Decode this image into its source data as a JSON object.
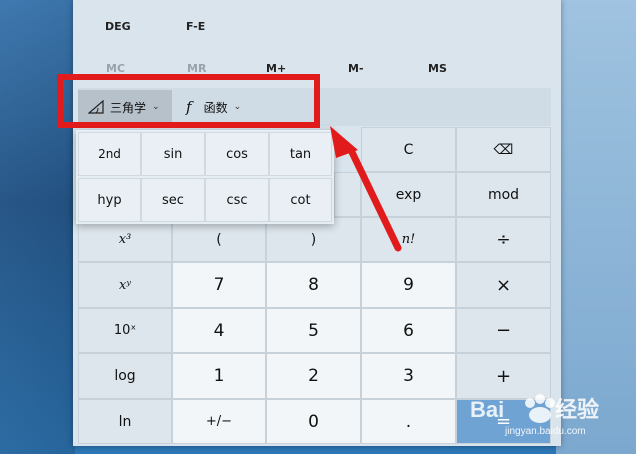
{
  "mode_row": {
    "deg": "DEG",
    "fe": "F-E"
  },
  "memory_row": {
    "mc": "MC",
    "mr": "MR",
    "mplus": "M+",
    "mminus": "M-",
    "ms": "MS"
  },
  "dropdowns": {
    "trig_label": "三角学",
    "func_label": "函数",
    "func_glyph": "f"
  },
  "popup_buttons": {
    "second": "2nd",
    "sin": "sin",
    "cos": "cos",
    "tan": "tan",
    "hyp": "hyp",
    "sec": "sec",
    "csc": "csc",
    "cot": "cot"
  },
  "keys": {
    "clear": "C",
    "backspace": "⌫",
    "exp": "exp",
    "mod": "mod",
    "x3": "x³",
    "lparen": "(",
    "rparen": ")",
    "factorial": "n!",
    "divide": "÷",
    "xy": "xʸ",
    "seven": "7",
    "eight": "8",
    "nine": "9",
    "multiply": "×",
    "tenx": "10ˣ",
    "four": "4",
    "five": "5",
    "six": "6",
    "minus": "−",
    "log": "log",
    "one": "1",
    "two": "2",
    "three": "3",
    "plus": "+",
    "ln": "ln",
    "negate": "+/−",
    "zero": "0",
    "decimal": ".",
    "equals": "="
  },
  "watermark": {
    "brand": "Bai du 经验",
    "site": "jingyan.baidu.com"
  },
  "colors": {
    "annotation_red": "#e11b1b",
    "equals_blue": "#6fa3d3"
  }
}
